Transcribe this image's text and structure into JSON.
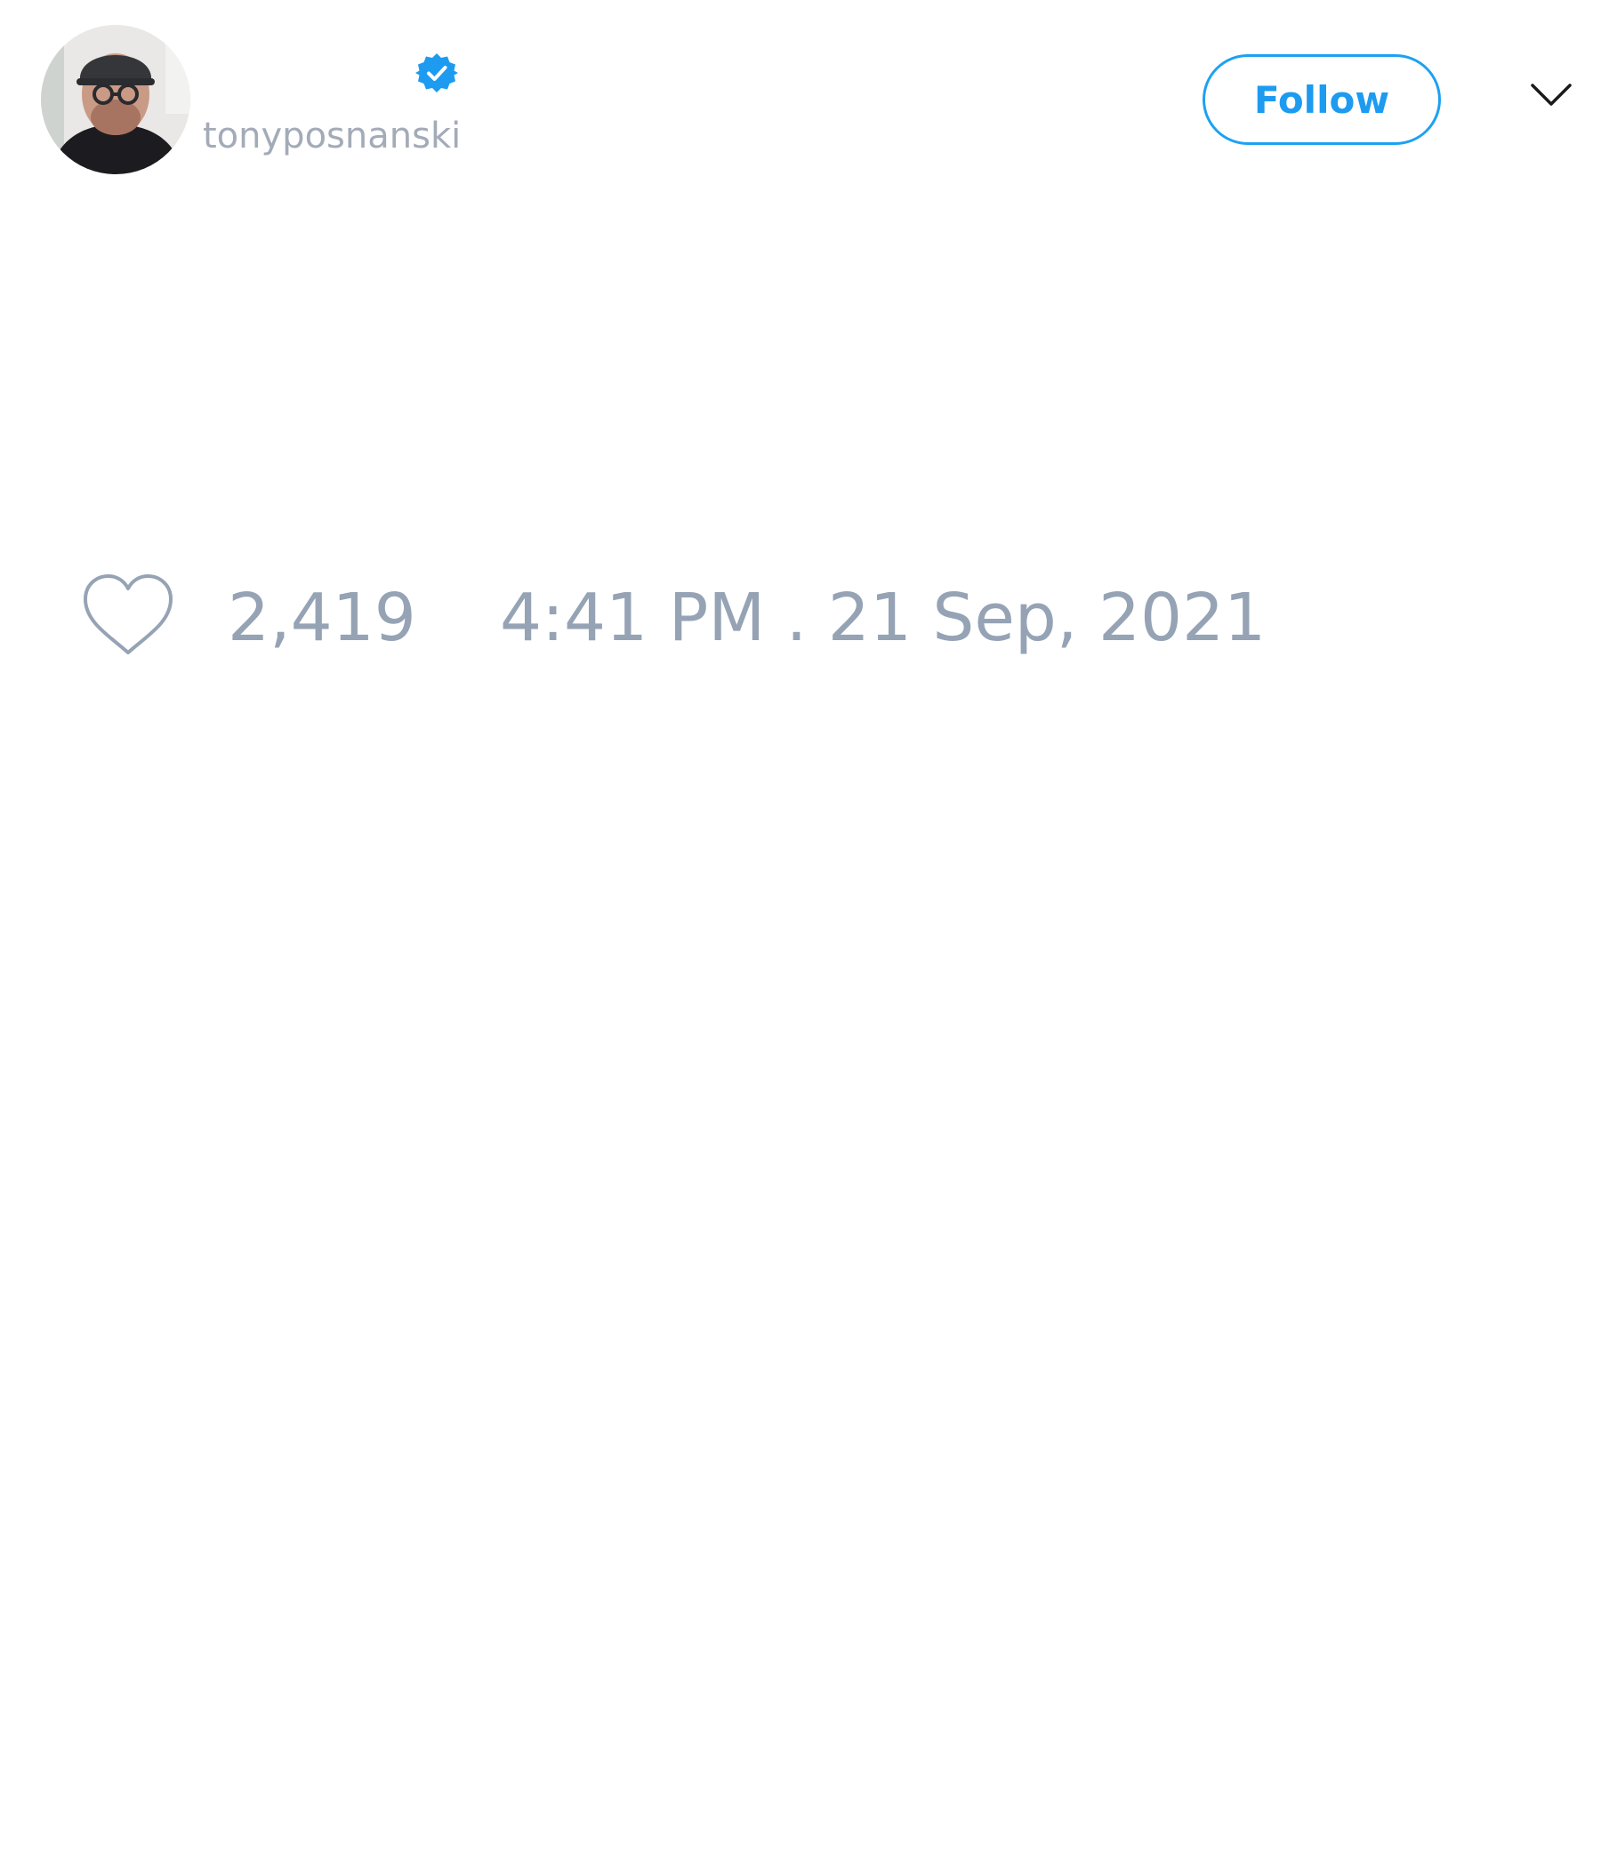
{
  "author": {
    "handle": "tonyposnanski",
    "verified": true
  },
  "header": {
    "follow_label": "Follow"
  },
  "tweet": {
    "like_count": "2,419",
    "timestamp": "4:41 PM . 21 Sep, 2021"
  },
  "icons": {
    "avatar": "profile-photo",
    "verified": "verified-badge-icon",
    "more": "chevron-down-icon",
    "like": "heart-icon"
  },
  "colors": {
    "accent": "#1da1f2",
    "muted_text": "#95a3b5",
    "handle_text": "#a3abb8",
    "background": "#ffffff"
  }
}
